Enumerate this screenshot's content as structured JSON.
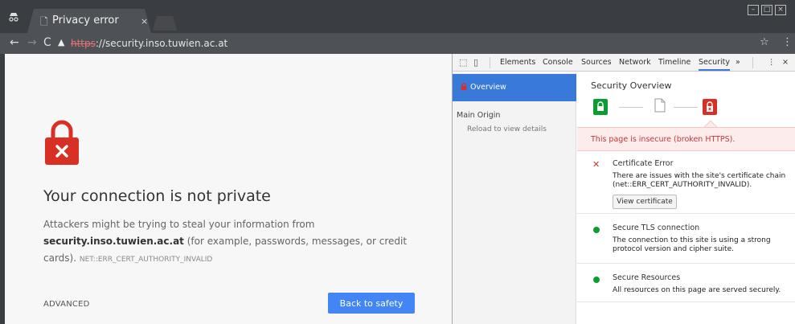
{
  "browser": {
    "tab_title": "Privacy error",
    "tab_close": "×",
    "url_scheme": "https",
    "url_rest": "://security.inso.tuwien.ac.at"
  },
  "page": {
    "headline": "Your connection is not private",
    "body_pre": "Attackers might be trying to steal your information from ",
    "host": "security.inso.tuwien.ac.at",
    "body_post": " (for example, passwords, messages, or credit cards). ",
    "error_code": "NET::ERR_CERT_AUTHORITY_INVALID",
    "advanced_label": "ADVANCED",
    "back_button": "Back to safety"
  },
  "devtools": {
    "tabs": [
      "Elements",
      "Console",
      "Sources",
      "Network",
      "Timeline",
      "Security"
    ],
    "more": "»",
    "close": "×",
    "sidebar": {
      "overview": "Overview",
      "main_origin": "Main Origin",
      "reload": "Reload to view details"
    },
    "main": {
      "title": "Security Overview",
      "insecure_msg": "This page is insecure (broken HTTPS).",
      "cert_title": "Certificate Error",
      "cert_desc": "There are issues with the site's certificate chain (net::ERR_CERT_AUTHORITY_INVALID).",
      "cert_button": "View certificate",
      "tls_title": "Secure TLS connection",
      "tls_desc": "The connection to this site is using a strong protocol version and cipher suite.",
      "res_title": "Secure Resources",
      "res_desc": "All resources on this page are served securely."
    }
  },
  "colors": {
    "danger": "#d93025",
    "secure": "#0b9d33",
    "accent": "#3879d9",
    "button": "#4285f4"
  }
}
